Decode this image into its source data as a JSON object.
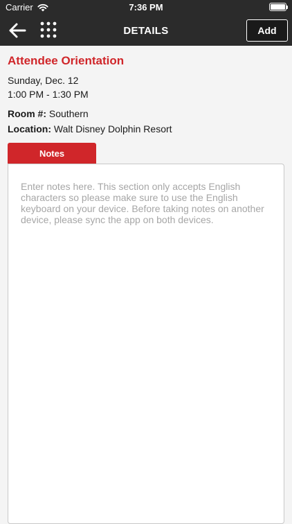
{
  "status_bar": {
    "carrier": "Carrier",
    "time": "7:36 PM",
    "icons": [
      "wifi-icon",
      "battery-icon"
    ]
  },
  "navbar": {
    "back_icon": "arrow-left-icon",
    "menu_icon": "grid-menu-icon",
    "title": "DETAILS",
    "add_label": "Add"
  },
  "session": {
    "title": "Attendee Orientation",
    "date": "Sunday, Dec. 12",
    "time": "1:00 PM - 1:30 PM",
    "room_label": "Room #:",
    "room_value": "Southern",
    "location_label": "Location:",
    "location_value": "Walt Disney Dolphin Resort"
  },
  "notes": {
    "tab_label": "Notes",
    "placeholder": "Enter notes here. This section only accepts English characters so please make sure to use the English keyboard on your device. Before taking notes on another device, please sync the app on both devices."
  },
  "colors": {
    "accent": "#d0262a",
    "header_bg": "#2b2b2b",
    "background": "#f4f4f4"
  }
}
